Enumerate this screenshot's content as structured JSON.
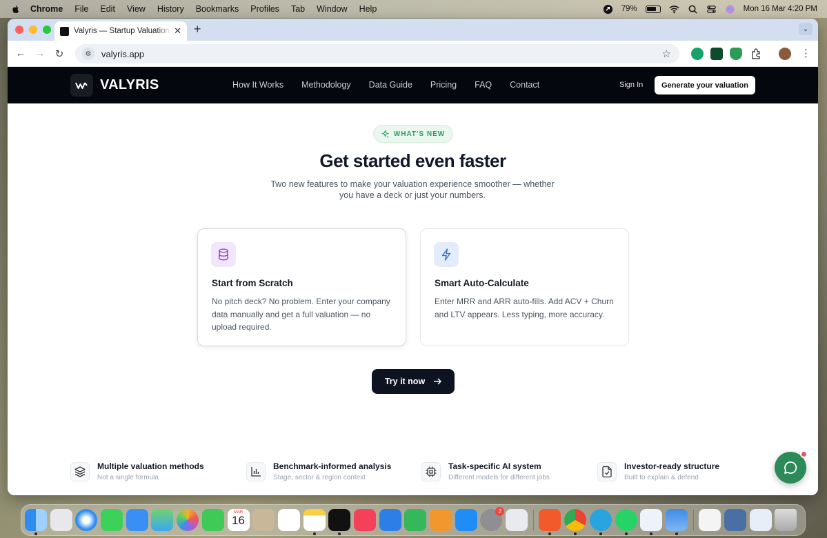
{
  "menubar": {
    "app": "Chrome",
    "items": [
      "File",
      "Edit",
      "View",
      "History",
      "Bookmarks",
      "Profiles",
      "Tab",
      "Window",
      "Help"
    ],
    "battery": "79%",
    "datetime": "Mon 16 Mar  4:20 PM"
  },
  "browser": {
    "tab_title": "Valyris — Startup Valuation & ...",
    "url": "valyris.app"
  },
  "site": {
    "logo": "VALYRIS",
    "nav": [
      "How It Works",
      "Methodology",
      "Data Guide",
      "Pricing",
      "FAQ",
      "Contact"
    ],
    "sign_in": "Sign In",
    "cta": "Generate your valuation"
  },
  "hero": {
    "badge": "WHAT'S NEW",
    "title": "Get started even faster",
    "subtitle": "Two new features to make your valuation experience smoother — whether you have a deck or just your numbers."
  },
  "cards": [
    {
      "icon": "database-icon",
      "title": "Start from Scratch",
      "description": "No pitch deck? No problem. Enter your company data manually and get a full valuation — no upload required."
    },
    {
      "icon": "lightning-icon",
      "title": "Smart Auto-Calculate",
      "description": "Enter MRR and ARR auto-fills. Add ACV + Churn and LTV appears. Less typing, more accuracy."
    }
  ],
  "try_button": "Try it now",
  "features": [
    {
      "icon": "layers-icon",
      "title": "Multiple valuation methods",
      "subtitle": "Not a single formula"
    },
    {
      "icon": "bar-chart-icon",
      "title": "Benchmark-informed analysis",
      "subtitle": "Stage, sector & region context"
    },
    {
      "icon": "chip-icon",
      "title": "Task-specific AI system",
      "subtitle": "Different models for different jobs"
    },
    {
      "icon": "file-check-icon",
      "title": "Investor-ready structure",
      "subtitle": "Built to explain & defend"
    }
  ],
  "dock": {
    "calendar_month": "MAR",
    "calendar_day": "16",
    "settings_badge": "2"
  },
  "colors": {
    "nav_bg": "#05070f",
    "accent_green": "#2f9a5e",
    "chat_button": "#2b8a57",
    "button_dark": "#0d1321"
  }
}
